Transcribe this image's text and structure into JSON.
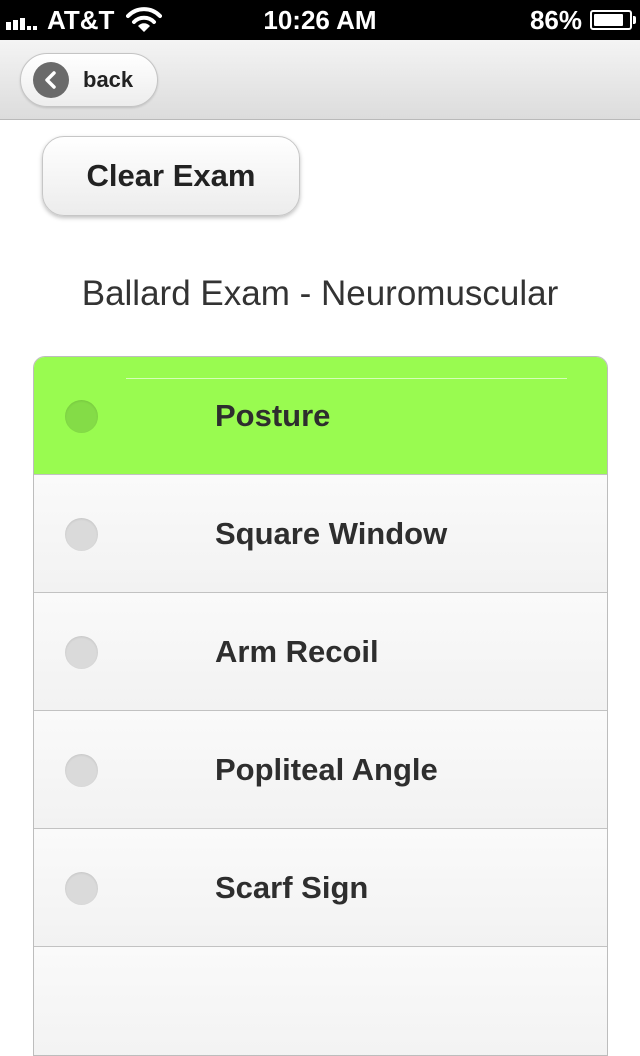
{
  "status_bar": {
    "carrier": "AT&T",
    "time": "10:26 AM",
    "battery_percent": "86%",
    "battery_level": 0.86,
    "signal_icon": "signal-bars-icon",
    "wifi_icon": "wifi-icon",
    "battery_icon": "battery-icon"
  },
  "nav": {
    "back_label": "back",
    "back_icon": "chevron-left-icon"
  },
  "actions": {
    "clear_label": "Clear Exam"
  },
  "section": {
    "title": "Ballard Exam - Neuromuscular"
  },
  "items": [
    {
      "label": "Posture",
      "selected": true
    },
    {
      "label": "Square Window",
      "selected": false
    },
    {
      "label": "Arm Recoil",
      "selected": false
    },
    {
      "label": "Popliteal Angle",
      "selected": false
    },
    {
      "label": "Scarf Sign",
      "selected": false
    },
    {
      "label": "",
      "selected": false
    }
  ],
  "colors": {
    "selected_row": "#99fb50",
    "status_bar": "#000000"
  }
}
